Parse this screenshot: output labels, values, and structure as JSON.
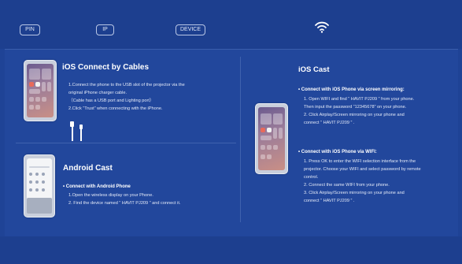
{
  "topbar": {
    "pin_label": "PIN",
    "ip_label": "IP",
    "device_label": "DEVICE"
  },
  "ios_cables": {
    "title": "iOS Connect by Cables",
    "lines": [
      "1.Connect the phone to the USB slot of the projector via the",
      "original iPhone charger cable.",
      "（Cable has a USB port and Lighting port）",
      "2.Click “Trust” when connecting with the iPhone."
    ]
  },
  "android": {
    "title": "Android Cast",
    "subtitle": "• Connect with Android Phone",
    "lines": [
      "1.Open the wireless display on your Phone.",
      "2. Find the device named “ HAVIT PJ209 ” and connect it."
    ]
  },
  "ios_cast": {
    "title": "iOS Cast",
    "mirror_subtitle": "• Connect with iOS Phone via screen mirroring:",
    "mirror_lines": [
      "1. Open WIFI and find “ HAVIT PJ209 ” from your phone.",
      "Then input the password “12345678” on your phone.",
      "2. Click Airplay/Screen mirroring on your phone and",
      "connect “ HAVIT PJ209 ” ."
    ],
    "wifi_subtitle": "• Connect with iOS Phone via WIFI:",
    "wifi_lines": [
      "1. Press OK to enter the WIFI selection interface from the",
      "projector. Choose your WIFI and select password by remote",
      "control.",
      "2. Connect the same WIFI from your phone.",
      "3. Click Airplay/Screen mirroring on your phone and",
      "connect “ HAVIT PJ209 ” ."
    ]
  },
  "icons": {
    "wifi": "wifi-icon",
    "cable": "lightning-cable-icon"
  },
  "colors": {
    "background": "#1f4396",
    "accent_text": "#ffffff"
  }
}
